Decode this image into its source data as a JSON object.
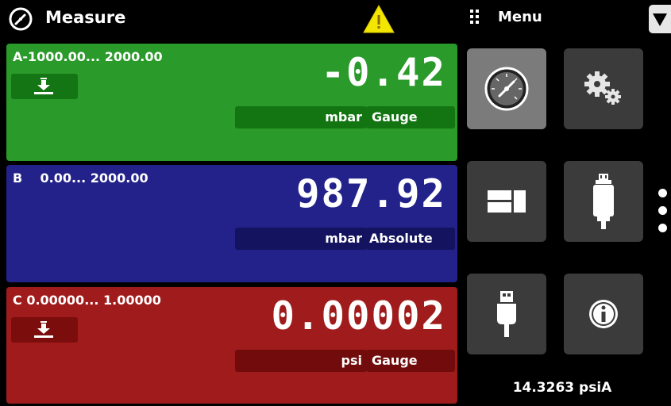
{
  "header": {
    "title": "Measure",
    "menu_label": "Menu",
    "icons": [
      "gauge-icon",
      "warning-icon",
      "grid-dots-icon",
      "dropdown-arrow-icon"
    ]
  },
  "channels": [
    {
      "range": "A-1000.00... 2000.00",
      "reading": "-0.42",
      "unit": "mbar",
      "mode": "Gauge",
      "color": "#2a9a2a",
      "tare_icon": "tare-icon"
    },
    {
      "range": "B    0.00... 2000.00",
      "reading": "987.92",
      "unit": "mbar",
      "mode": "Absolute",
      "color": "#22228a"
    },
    {
      "range": "C 0.00000... 1.00000",
      "reading": "0.00002",
      "unit": "psi",
      "mode": "Gauge",
      "color": "#a01c1c",
      "tare_icon": "tare-icon"
    }
  ],
  "menu": {
    "tiles": [
      "measure-gauge-icon",
      "settings-gears-icon",
      "display-layout-icon",
      "sensor-transducer-icon",
      "usb-icon",
      "info-icon"
    ],
    "barometer": "14.3263 psiA",
    "page_count": 3
  }
}
